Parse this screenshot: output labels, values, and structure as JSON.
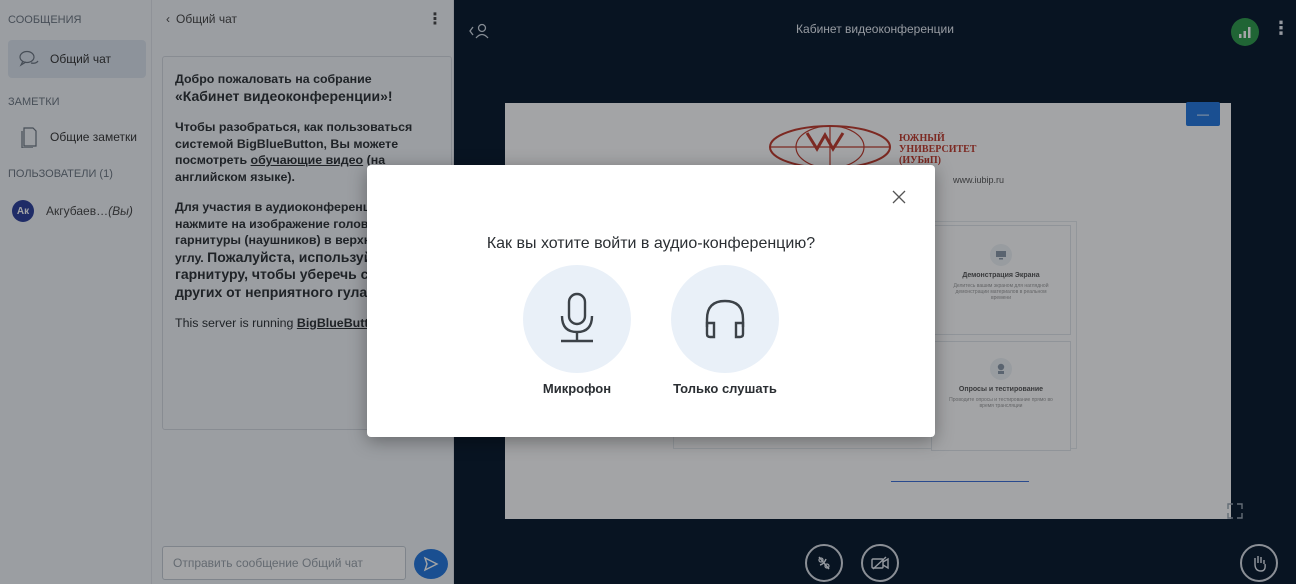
{
  "sidebar": {
    "messages_header": "СООБЩЕНИЯ",
    "public_chat": "Общий чат",
    "notes_header": "ЗАМЕТКИ",
    "shared_notes": "Общие заметки",
    "users_header": "ПОЛЬЗОВАТЕЛИ (1)",
    "user": {
      "initials": "Ак",
      "name": "Акгубаев…",
      "you_tag": "(Вы)"
    }
  },
  "chat": {
    "back_label": "Общий чат",
    "welcome": {
      "p1_a": "Добро пожаловать на собрание",
      "p1_b": "«Кабинет видеоконференции»!",
      "p2_a": "Чтобы разобраться, как пользоваться системой BigBlueButton, Вы можете посмотреть ",
      "p2_link": "обучающие видео",
      "p2_b": " (на английском языке).",
      "p3_a": "Для участия в аудиоконференции нажмите на изображение головной гарнитуры (наушников) в верхнем левом углу. ",
      "p3_b": "Пожалуйста, используйте гарнитуру, чтобы уберечь себя и других от неприятного гула.",
      "p4_a": "This server is running ",
      "p4_link": "BigBlueButton"
    },
    "input_placeholder": "Отправить сообщение Общий чат"
  },
  "main": {
    "room_title": "Кабинет видеоконференции",
    "slide": {
      "university_lines": [
        "ЮЖНЫЙ",
        "УНИВЕРСИТЕТ",
        "(ИУБиП)"
      ],
      "url": "www.iubip.ru",
      "cards": [
        {
          "title": "Демонстрация Экрана",
          "desc": "Делитесь вашим экраном для наглядной демонстрации материалов в реальном времени"
        },
        {
          "title": "Опросы и тестирование",
          "desc": "Проводите опросы и тестирование прямо во время трансляции"
        }
      ]
    },
    "minimize_label": "—"
  },
  "modal": {
    "question": "Как вы хотите войти в аудио-конференцию?",
    "microphone_label": "Микрофон",
    "listen_only_label": "Только слушать"
  },
  "colors": {
    "accent": "#2277dd",
    "main_bg": "#06172a",
    "panel_bg": "#f3f6f9",
    "signal": "#2d9a4a"
  },
  "icons": [
    "chat-icon",
    "notes-icon",
    "users-toggle-icon",
    "signal-icon",
    "kebab-icon",
    "close-icon",
    "microphone-icon",
    "headphones-icon",
    "send-icon",
    "mute-icon",
    "video-off-icon",
    "raise-hand-icon",
    "fullscreen-icon",
    "chevron-left-icon"
  ]
}
